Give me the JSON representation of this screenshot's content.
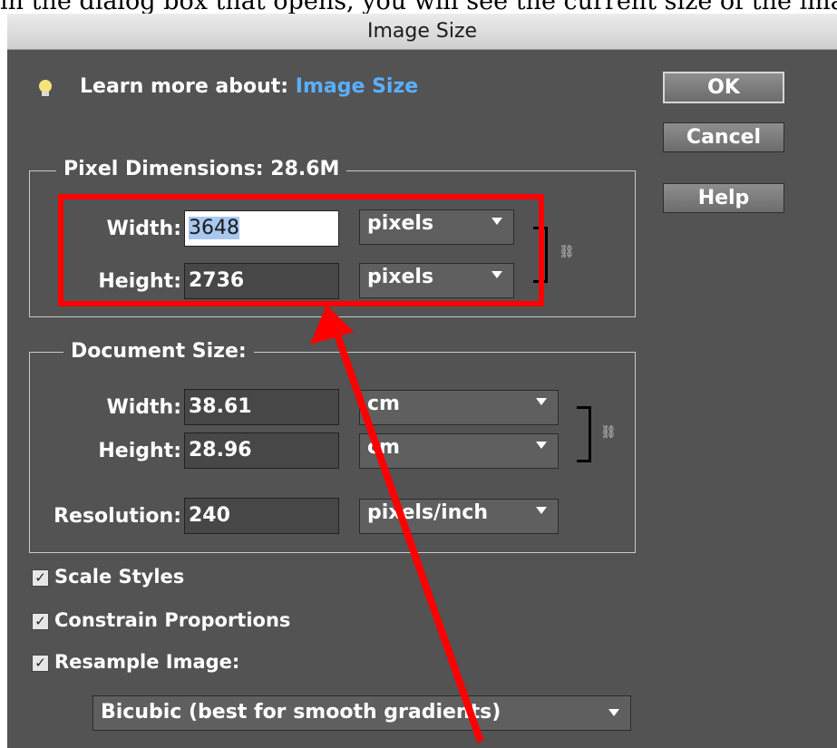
{
  "header_text": "in the dialog box that opens, you will see the current size of the image",
  "title": "Image Size",
  "learn_more": {
    "prefix": "Learn more about:",
    "link": "Image Size"
  },
  "buttons": {
    "ok": "OK",
    "cancel": "Cancel",
    "help": "Help"
  },
  "pixel_dimensions": {
    "legend": "Pixel Dimensions:",
    "size": "28.6M",
    "width_label": "Width:",
    "width_value": "3648",
    "width_unit": "pixels",
    "height_label": "Height:",
    "height_value": "2736",
    "height_unit": "pixels"
  },
  "document_size": {
    "legend": "Document Size:",
    "width_label": "Width:",
    "width_value": "38.61",
    "width_unit": "cm",
    "height_label": "Height:",
    "height_value": "28.96",
    "height_unit": "cm",
    "resolution_label": "Resolution:",
    "resolution_value": "240",
    "resolution_unit": "pixels/inch"
  },
  "options": {
    "scale_styles": {
      "label": "Scale Styles",
      "checked": true
    },
    "constrain_proportions": {
      "label": "Constrain Proportions",
      "checked": true
    },
    "resample_image": {
      "label": "Resample Image:",
      "checked": true
    }
  },
  "resample_method": "Bicubic (best for smooth gradients)",
  "colors": {
    "dialog_bg": "#535353",
    "link": "#5ab0ff",
    "annotation": "#ff0000",
    "field_dark": "#474747"
  },
  "icons": {
    "tip": "lightbulb-icon",
    "chain": "chain-link-icon",
    "checkbox": "checkmark-icon",
    "dropdown": "chevron-down-icon"
  }
}
